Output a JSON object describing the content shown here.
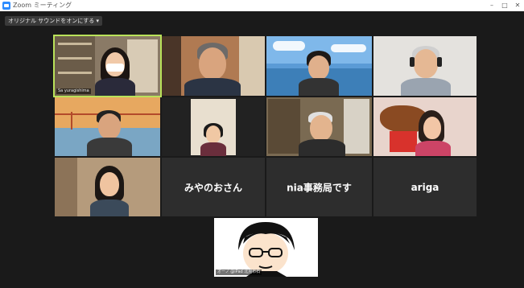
{
  "window": {
    "title": "Zoom ミーティング",
    "controls": [
      "–",
      "□",
      "✕"
    ]
  },
  "toolbar": {
    "original_sound_label": "オリジナル サウンドをオンにする ▾"
  },
  "participants": [
    {
      "id": "p1",
      "name": "Sa yuragishima",
      "type": "video",
      "active": true
    },
    {
      "id": "p2",
      "name": "",
      "type": "video"
    },
    {
      "id": "p3",
      "name": "",
      "type": "video"
    },
    {
      "id": "p4",
      "name": "",
      "type": "video"
    },
    {
      "id": "p5",
      "name": "",
      "type": "video"
    },
    {
      "id": "p6",
      "name": "",
      "type": "video"
    },
    {
      "id": "p7",
      "name": "",
      "type": "video"
    },
    {
      "id": "p8",
      "name": "",
      "type": "video"
    },
    {
      "id": "p9",
      "name": "",
      "type": "video"
    },
    {
      "id": "p10",
      "name": "みやのおさん",
      "type": "name-only"
    },
    {
      "id": "p11",
      "name": "nia事務局です",
      "type": "name-only"
    },
    {
      "id": "p12",
      "name": "ariga",
      "type": "name-only"
    },
    {
      "id": "p13",
      "name": "オーノ @iPad 北見市石",
      "type": "avatar"
    }
  ]
}
